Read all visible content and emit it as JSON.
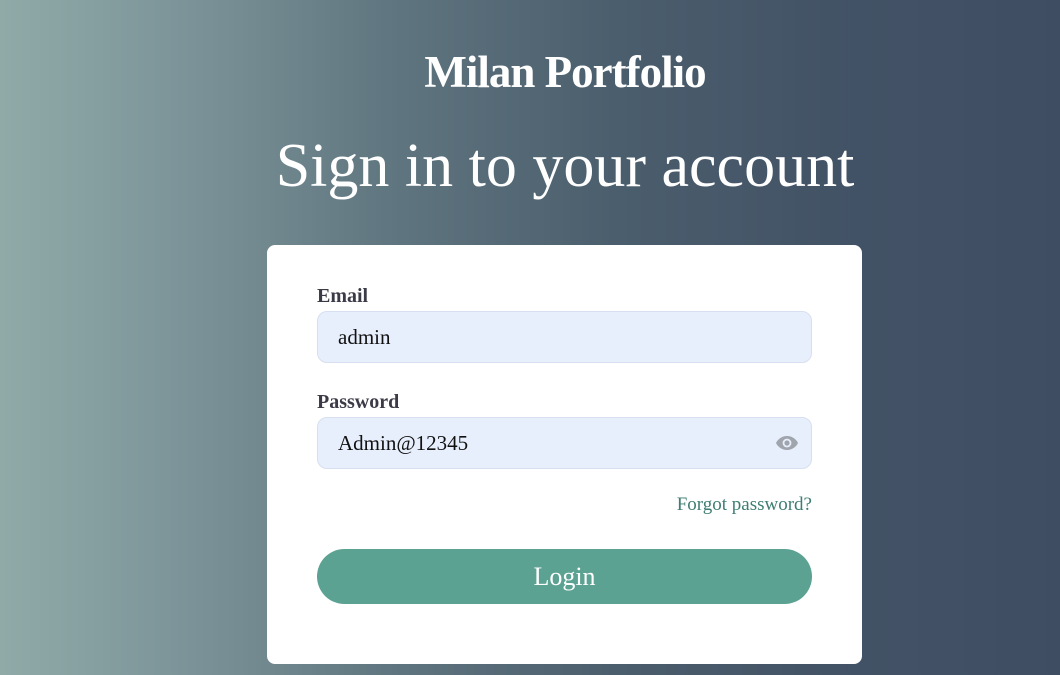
{
  "brand": {
    "title": "Milan Portfolio"
  },
  "page": {
    "heading": "Sign in to your account"
  },
  "form": {
    "email": {
      "label": "Email",
      "value": "admin"
    },
    "password": {
      "label": "Password",
      "value": "Admin@12345",
      "toggle_icon": "eye-icon"
    },
    "forgot_link": "Forgot password?",
    "submit_label": "Login"
  },
  "colors": {
    "accent": "#5ba292",
    "link": "#3f7d72",
    "input_bg": "#e8effc",
    "card_bg": "#ffffff"
  }
}
